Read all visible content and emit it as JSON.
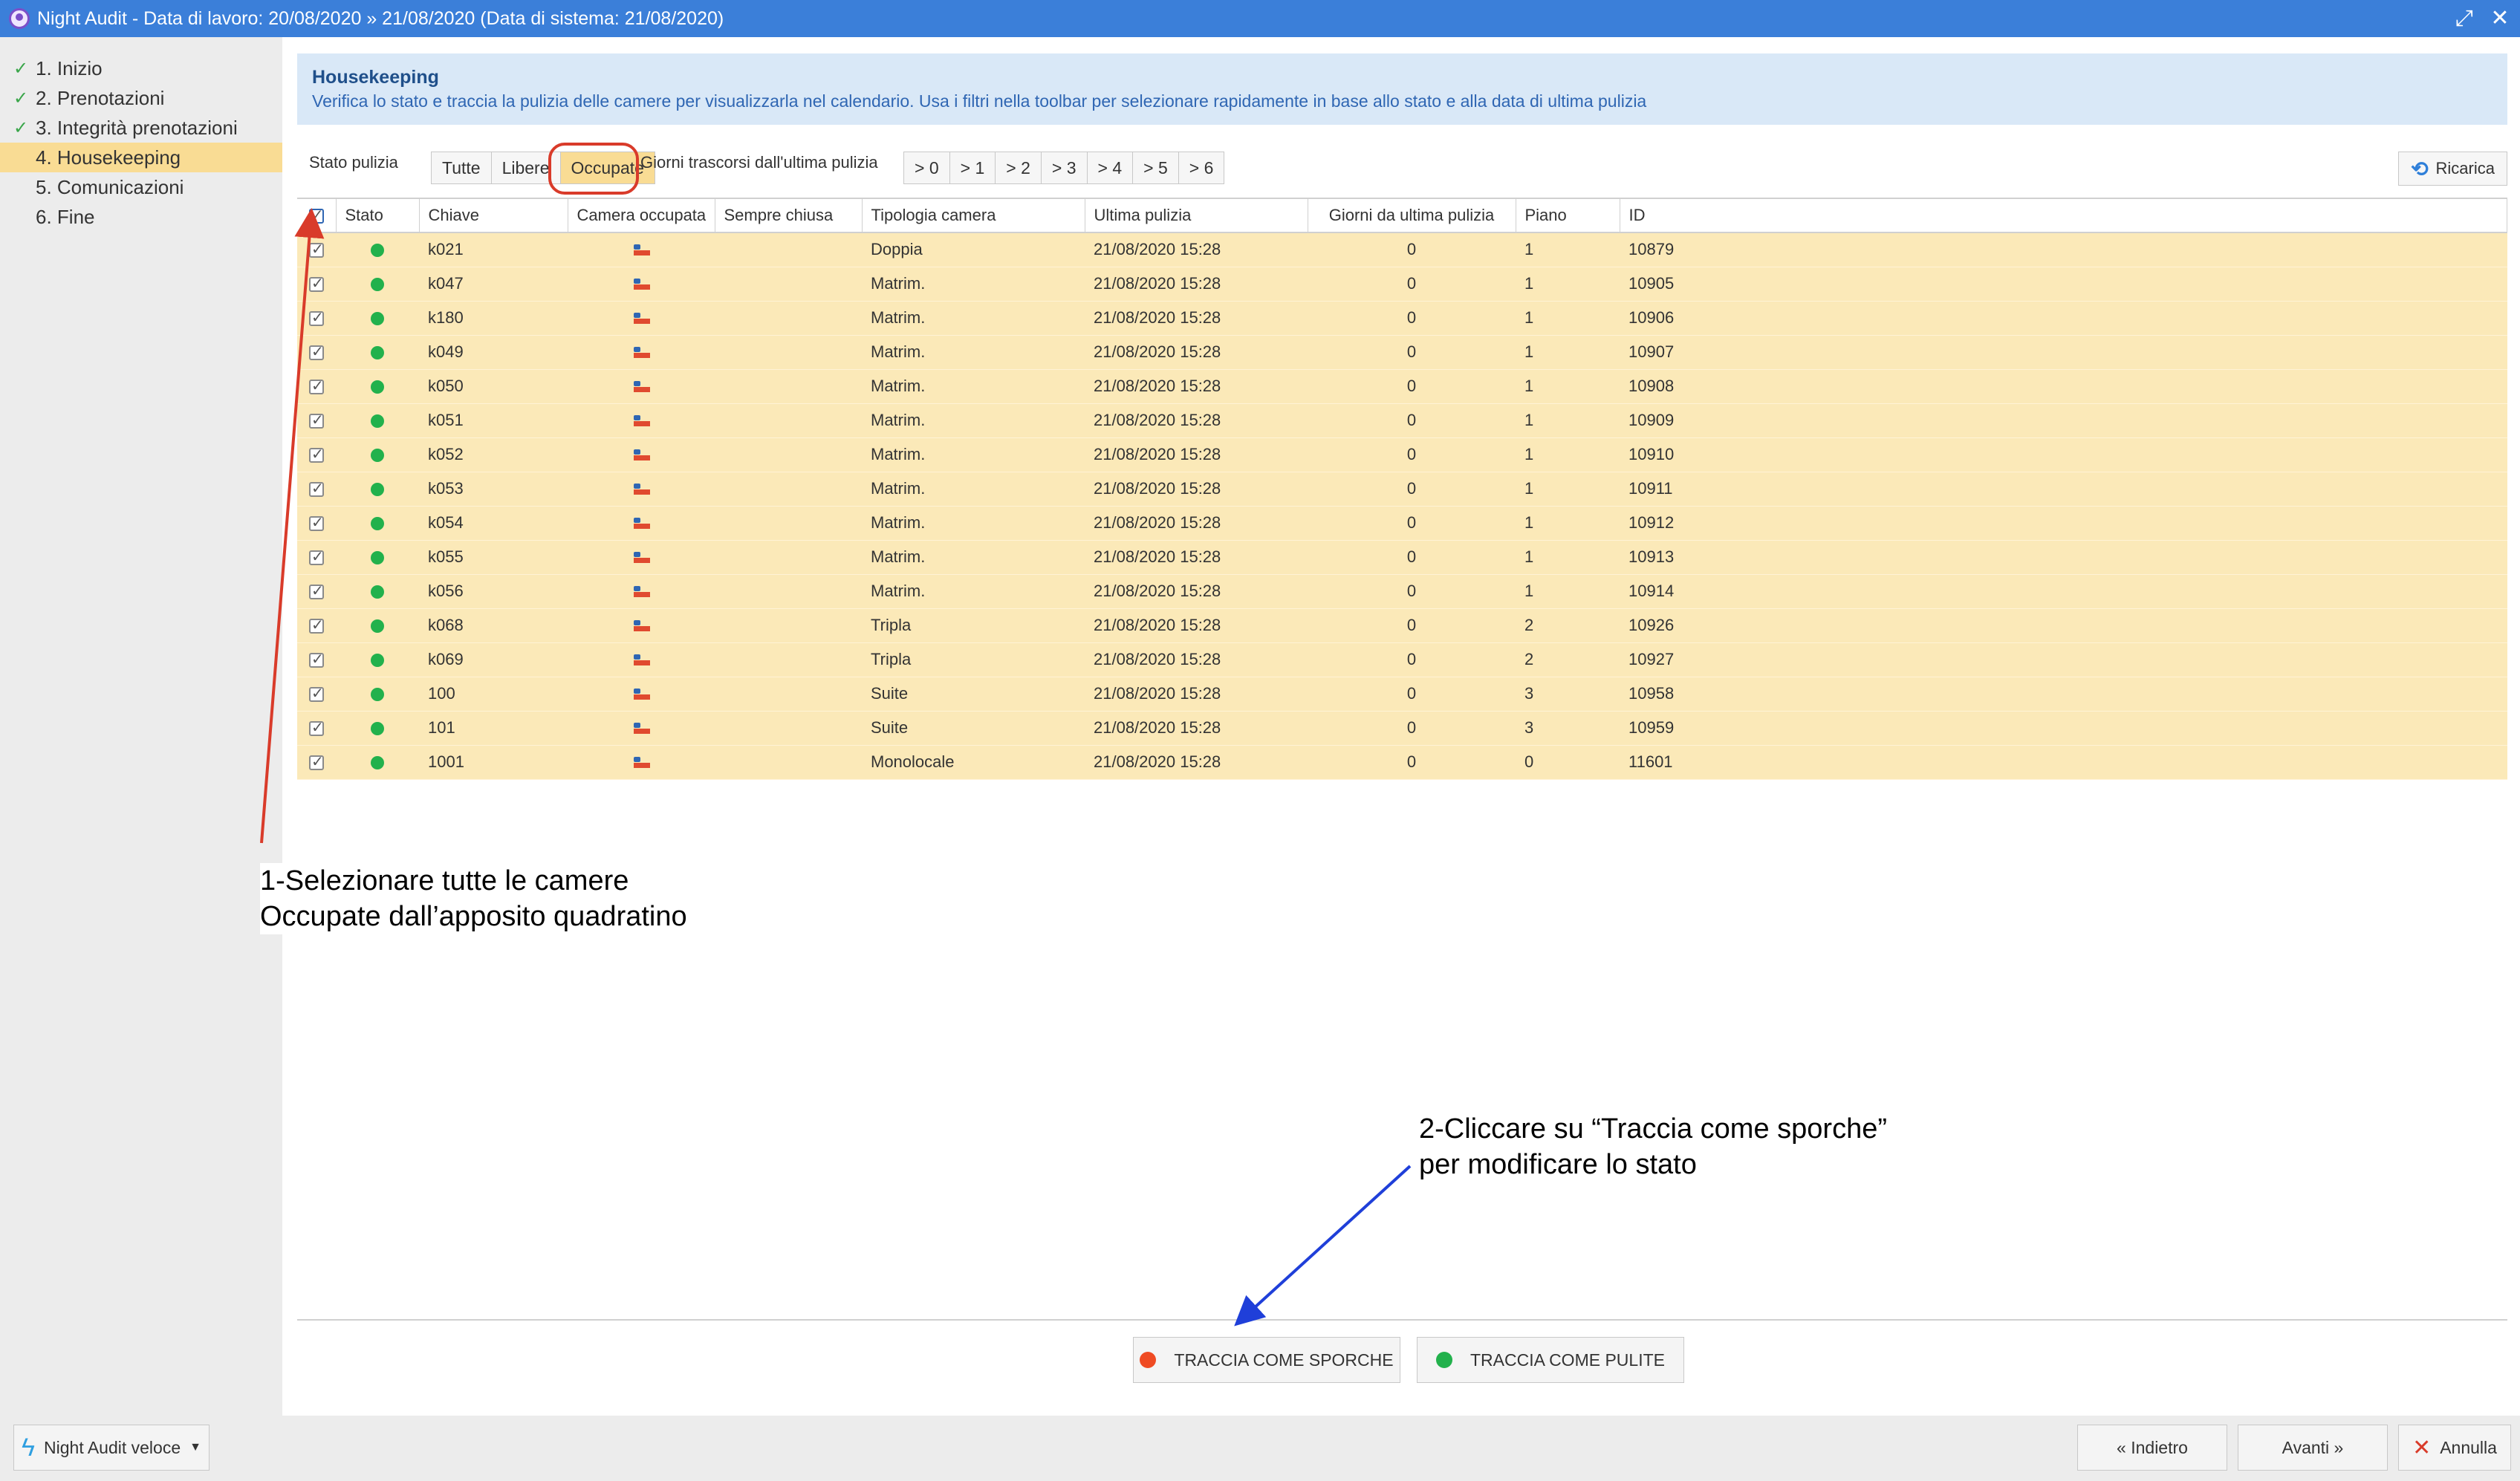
{
  "window": {
    "title": "Night Audit - Data di lavoro: 20/08/2020 » 21/08/2020 (Data di sistema: 21/08/2020)"
  },
  "sidebar": {
    "steps": [
      {
        "label": "1. Inizio",
        "done": true
      },
      {
        "label": "2. Prenotazioni",
        "done": true
      },
      {
        "label": "3. Integrità prenotazioni",
        "done": true
      },
      {
        "label": "4. Housekeeping",
        "done": false,
        "active": true
      },
      {
        "label": "5. Comunicazioni",
        "done": false
      },
      {
        "label": "6. Fine",
        "done": false
      }
    ]
  },
  "info": {
    "heading": "Housekeeping",
    "description": "Verifica lo stato e traccia la pulizia delle camere per visualizzarla nel calendario. Usa i filtri nella toolbar per selezionare rapidamente in base allo stato e alla data di ultima pulizia"
  },
  "toolbar": {
    "stato_label": "Stato pulizia",
    "stato_options": [
      "Tutte",
      "Libere",
      "Occupate"
    ],
    "stato_selected": "Occupate",
    "giorni_label": "Giorni trascorsi dall'ultima pulizia",
    "giorni_options": [
      "> 0",
      "> 1",
      "> 2",
      "> 3",
      "> 4",
      "> 5",
      "> 6"
    ],
    "reload_label": "Ricarica"
  },
  "table": {
    "columns": [
      "Stato",
      "Chiave",
      "Camera occupata",
      "Sempre chiusa",
      "Tipologia camera",
      "Ultima pulizia",
      "Giorni da ultima pulizia",
      "Piano",
      "ID"
    ],
    "rows": [
      {
        "chiave": "k021",
        "tipologia": "Doppia",
        "ultima": "21/08/2020 15:28",
        "giorni": "0",
        "piano": "1",
        "id": "10879"
      },
      {
        "chiave": "k047",
        "tipologia": "Matrim.",
        "ultima": "21/08/2020 15:28",
        "giorni": "0",
        "piano": "1",
        "id": "10905"
      },
      {
        "chiave": "k180",
        "tipologia": "Matrim.",
        "ultima": "21/08/2020 15:28",
        "giorni": "0",
        "piano": "1",
        "id": "10906"
      },
      {
        "chiave": "k049",
        "tipologia": "Matrim.",
        "ultima": "21/08/2020 15:28",
        "giorni": "0",
        "piano": "1",
        "id": "10907"
      },
      {
        "chiave": "k050",
        "tipologia": "Matrim.",
        "ultima": "21/08/2020 15:28",
        "giorni": "0",
        "piano": "1",
        "id": "10908"
      },
      {
        "chiave": "k051",
        "tipologia": "Matrim.",
        "ultima": "21/08/2020 15:28",
        "giorni": "0",
        "piano": "1",
        "id": "10909"
      },
      {
        "chiave": "k052",
        "tipologia": "Matrim.",
        "ultima": "21/08/2020 15:28",
        "giorni": "0",
        "piano": "1",
        "id": "10910"
      },
      {
        "chiave": "k053",
        "tipologia": "Matrim.",
        "ultima": "21/08/2020 15:28",
        "giorni": "0",
        "piano": "1",
        "id": "10911"
      },
      {
        "chiave": "k054",
        "tipologia": "Matrim.",
        "ultima": "21/08/2020 15:28",
        "giorni": "0",
        "piano": "1",
        "id": "10912"
      },
      {
        "chiave": "k055",
        "tipologia": "Matrim.",
        "ultima": "21/08/2020 15:28",
        "giorni": "0",
        "piano": "1",
        "id": "10913"
      },
      {
        "chiave": "k056",
        "tipologia": "Matrim.",
        "ultima": "21/08/2020 15:28",
        "giorni": "0",
        "piano": "1",
        "id": "10914"
      },
      {
        "chiave": "k068",
        "tipologia": "Tripla",
        "ultima": "21/08/2020 15:28",
        "giorni": "0",
        "piano": "2",
        "id": "10926"
      },
      {
        "chiave": "k069",
        "tipologia": "Tripla",
        "ultima": "21/08/2020 15:28",
        "giorni": "0",
        "piano": "2",
        "id": "10927"
      },
      {
        "chiave": "100",
        "tipologia": "Suite",
        "ultima": "21/08/2020 15:28",
        "giorni": "0",
        "piano": "3",
        "id": "10958"
      },
      {
        "chiave": "101",
        "tipologia": "Suite",
        "ultima": "21/08/2020 15:28",
        "giorni": "0",
        "piano": "3",
        "id": "10959"
      },
      {
        "chiave": "1001",
        "tipologia": "Monolocale",
        "ultima": "21/08/2020 15:28",
        "giorni": "0",
        "piano": "0",
        "id": "11601"
      }
    ]
  },
  "annotations": {
    "note1_line1": "1-Selezionare tutte le camere",
    "note1_line2": "Occupate   dall’apposito quadratino",
    "note2_line1": "2-Cliccare su “Traccia come sporche”",
    "note2_line2": "per modificare lo stato"
  },
  "actions": {
    "dirty_label": "TRACCIA COME SPORCHE",
    "clean_label": "TRACCIA COME PULITE",
    "dirty_color": "#ef4b23",
    "clean_color": "#22b14c"
  },
  "footer": {
    "quick_label": "Night Audit veloce",
    "back_label": "« Indietro",
    "next_label": "Avanti »",
    "cancel_label": "Annulla"
  },
  "colors": {
    "accent": "#3b7fd9",
    "row_highlight": "#fbe9b8",
    "active_step": "#f9dc94",
    "annotation_red": "#d93b2a",
    "annotation_blue": "#1f3fd9"
  }
}
